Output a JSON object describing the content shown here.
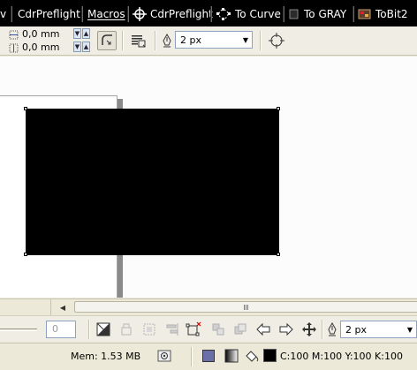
{
  "menubar": {
    "partial_item": "v",
    "item1": "CdrPreflight",
    "item2": "Macros",
    "item3": "CdrPreflight",
    "item4": "To Curve",
    "item5": "To GRAY",
    "item6": "ToBit2"
  },
  "propbar": {
    "size_x": "0,0 mm",
    "size_y": "0,0 mm",
    "outline_width": "2 px"
  },
  "bottombar": {
    "field_value": "0",
    "outline_width": "2 px"
  },
  "statusbar": {
    "memory": "Mem: 1.53 MB",
    "fill_color": "#6b6fa8",
    "outline_color": "#000000",
    "cmyk": "C:100 M:100 Y:100 K:100"
  },
  "canvas": {
    "object_color": "#000000"
  }
}
